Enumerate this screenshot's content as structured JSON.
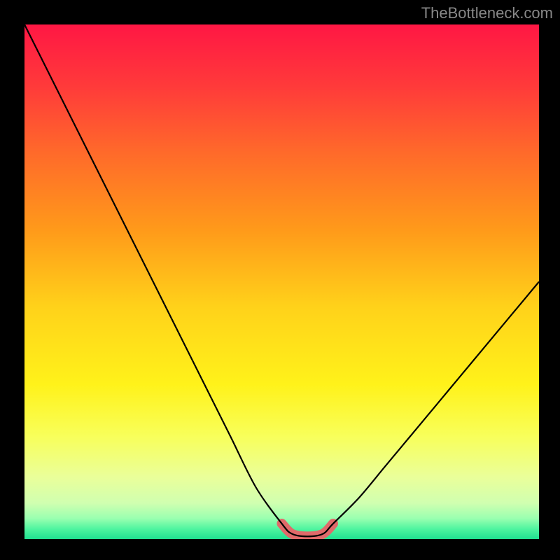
{
  "watermark": "TheBottleneck.com",
  "chart_data": {
    "type": "line",
    "title": "",
    "xlabel": "",
    "ylabel": "",
    "x": [
      0,
      5,
      10,
      15,
      20,
      25,
      30,
      35,
      40,
      45,
      50,
      52,
      55,
      58,
      60,
      65,
      70,
      75,
      80,
      85,
      90,
      95,
      100
    ],
    "values": [
      100,
      90,
      80,
      70,
      60,
      50,
      40,
      30,
      20,
      10,
      3,
      1,
      0.5,
      1,
      3,
      8,
      14,
      20,
      26,
      32,
      38,
      44,
      50
    ],
    "xlim": [
      0,
      100
    ],
    "ylim": [
      0,
      100
    ],
    "background_gradient": {
      "stops": [
        {
          "pos": 0.0,
          "color": "#ff1744"
        },
        {
          "pos": 0.12,
          "color": "#ff3a3a"
        },
        {
          "pos": 0.25,
          "color": "#ff6a2a"
        },
        {
          "pos": 0.4,
          "color": "#ff9a1a"
        },
        {
          "pos": 0.55,
          "color": "#ffd21a"
        },
        {
          "pos": 0.7,
          "color": "#fff21a"
        },
        {
          "pos": 0.8,
          "color": "#f8ff5a"
        },
        {
          "pos": 0.88,
          "color": "#eaff9a"
        },
        {
          "pos": 0.93,
          "color": "#d0ffb0"
        },
        {
          "pos": 0.96,
          "color": "#9affb0"
        },
        {
          "pos": 0.98,
          "color": "#50f5a0"
        },
        {
          "pos": 1.0,
          "color": "#20e090"
        }
      ]
    },
    "highlight_segment": {
      "x_start": 50,
      "x_end": 60,
      "color": "#e06a6a",
      "width": 14
    },
    "curve_color": "#000000",
    "curve_width": 2.2
  }
}
